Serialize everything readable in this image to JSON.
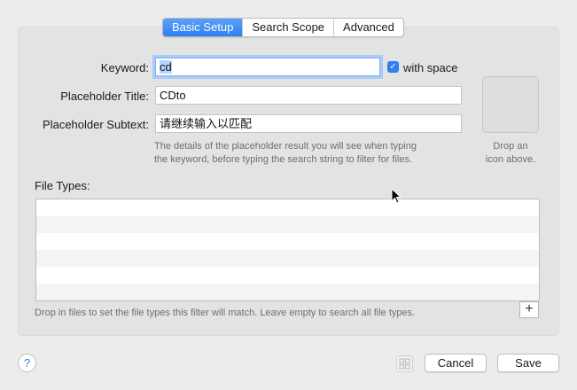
{
  "tabs": [
    {
      "label": "Basic Setup",
      "active": true
    },
    {
      "label": "Search Scope",
      "active": false
    },
    {
      "label": "Advanced",
      "active": false
    }
  ],
  "form": {
    "keyword_label": "Keyword:",
    "keyword_value": "cd",
    "with_space_label": "with space",
    "with_space_checked": true,
    "placeholder_title_label": "Placeholder Title:",
    "placeholder_title_value": "CDto",
    "placeholder_subtext_label": "Placeholder Subtext:",
    "placeholder_subtext_value": "请继续输入以匹配",
    "hint_line1": "The details of the placeholder result you will see when typing",
    "hint_line2": "the keyword, before typing the search string to filter for files."
  },
  "icon_well": {
    "caption_line1": "Drop an",
    "caption_line2": "icon above."
  },
  "file_types": {
    "label": "File Types:",
    "hint": "Drop in files to set the file types this filter will match. Leave empty to search all file types.",
    "add_label": "+"
  },
  "footer": {
    "help_label": "?",
    "cancel_label": "Cancel",
    "save_label": "Save"
  },
  "colors": {
    "accent": "#2f7ff1",
    "panel": "#e3e3e3",
    "window": "#ececec"
  }
}
